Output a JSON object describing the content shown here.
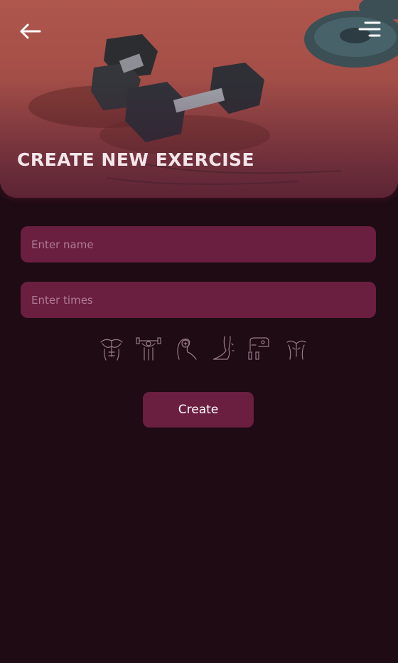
{
  "header": {
    "title": "CREATE NEW EXERCISE",
    "back_icon": "arrow-left-icon",
    "menu_icon": "menu-icon"
  },
  "form": {
    "name_placeholder": "Enter name",
    "name_value": "",
    "times_placeholder": "Enter times",
    "times_value": ""
  },
  "muscle_groups": [
    {
      "icon": "chest-icon"
    },
    {
      "icon": "shoulders-icon"
    },
    {
      "icon": "biceps-icon"
    },
    {
      "icon": "legs-icon"
    },
    {
      "icon": "cardio-icon"
    },
    {
      "icon": "back-icon"
    }
  ],
  "actions": {
    "create_label": "Create"
  },
  "colors": {
    "background": "#1e0b13",
    "field": "#6a1e40",
    "placeholder": "#b07d93",
    "title": "#f4e6ea"
  }
}
